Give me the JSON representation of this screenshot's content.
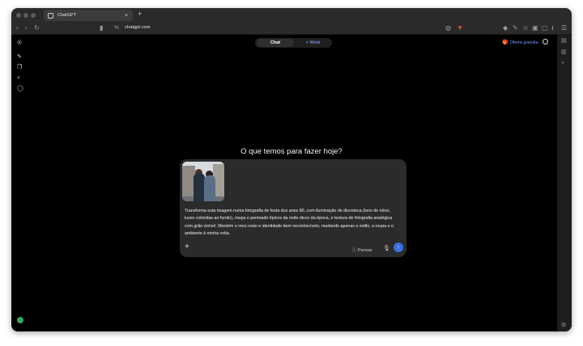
{
  "browser": {
    "tab": {
      "title": "ChatGPT",
      "close": "×"
    },
    "new_tab": "+",
    "nav": {
      "back": "‹",
      "forward": "›",
      "reload": "↻"
    },
    "url": "chatgpt.com",
    "site_icon": "⇆",
    "bookmark_icon": "▮",
    "extensions": {
      "shield": "◍",
      "brave": "▼",
      "icons": [
        "◆",
        "✎",
        "☺",
        "▣",
        "▢",
        "⭳",
        "☰"
      ]
    }
  },
  "sidebar": {
    "icons": [
      {
        "name": "openai-logo-icon",
        "glyph": "◎"
      },
      {
        "name": "new-chat-icon",
        "glyph": "✎"
      },
      {
        "name": "images-icon",
        "glyph": "❐"
      },
      {
        "name": "search-icon",
        "glyph": "⌕"
      },
      {
        "name": "library-icon",
        "glyph": "◯"
      }
    ]
  },
  "header": {
    "mode_chat": "Chat",
    "mode_work": "+ Work",
    "offer": "Oferta gratuita",
    "offer_icon": "🎁"
  },
  "main": {
    "headline": "O que temos para fazer hoje?"
  },
  "composer": {
    "prompt": "Transforma esta imagem numa fotografia de festa dos anos 80, com iluminação de discoteca (tons de néon, luzes coloridas ao fundo), roupa e penteado típicos da noite disco da época, e textura de fotografia analógica com grão visível. Mantém o meu rosto e identidade bem reconhecíveis, mudando apenas o estilo, a roupa e o ambiente à minha volta.",
    "add": "+",
    "think_label": "Pensar",
    "think_icon": "ⓘ",
    "mic": "🎙",
    "send": "↑"
  }
}
